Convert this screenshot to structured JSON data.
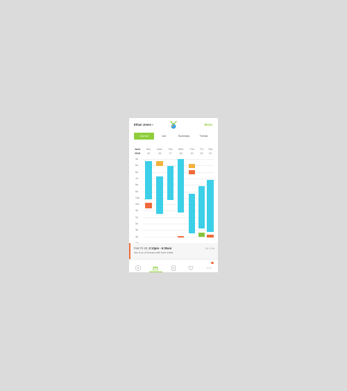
{
  "colors": {
    "accent": "#8fce3b",
    "bar": "#3ccfe8",
    "orange": "#f3b13c",
    "red": "#ef6a3a",
    "green": "#86c33c"
  },
  "header": {
    "username": "Ethan Jones",
    "menu_label": "Menu"
  },
  "tabs": [
    {
      "label": "Journal",
      "active": true
    },
    {
      "label": "List",
      "active": false
    },
    {
      "label": "Summary",
      "active": false
    },
    {
      "label": "Trends",
      "active": false
    }
  ],
  "calendar": {
    "month": "June",
    "year": "2018",
    "days": [
      {
        "name": "Sun",
        "num": "15"
      },
      {
        "name": "Mon",
        "num": "16"
      },
      {
        "name": "Tue",
        "num": "17"
      },
      {
        "name": "Wed",
        "num": "18"
      },
      {
        "name": "Thu",
        "num": "19"
      },
      {
        "name": "Fri",
        "num": "20"
      },
      {
        "name": "Sat",
        "num": "21"
      }
    ],
    "hours": [
      "4a",
      "5a",
      "6a",
      "7a",
      "8a",
      "9a",
      "10a",
      "11a",
      "4p",
      "1p",
      "2p",
      "3p",
      "4p",
      "11p",
      "6a"
    ]
  },
  "entry": {
    "title_prefix": "Feb Fri 20,",
    "time_range": "2:13pm - 6:30am",
    "meta": "2h 17m",
    "description": "Ate 8 oz of breast milk from bottle"
  },
  "bottom_nav": [
    {
      "icon": "add-icon",
      "active": false
    },
    {
      "icon": "crown-icon",
      "active": true
    },
    {
      "icon": "notebook-icon",
      "active": false
    },
    {
      "icon": "heart-icon",
      "active": false
    },
    {
      "icon": "more-icon",
      "active": false,
      "badge": true
    }
  ]
}
